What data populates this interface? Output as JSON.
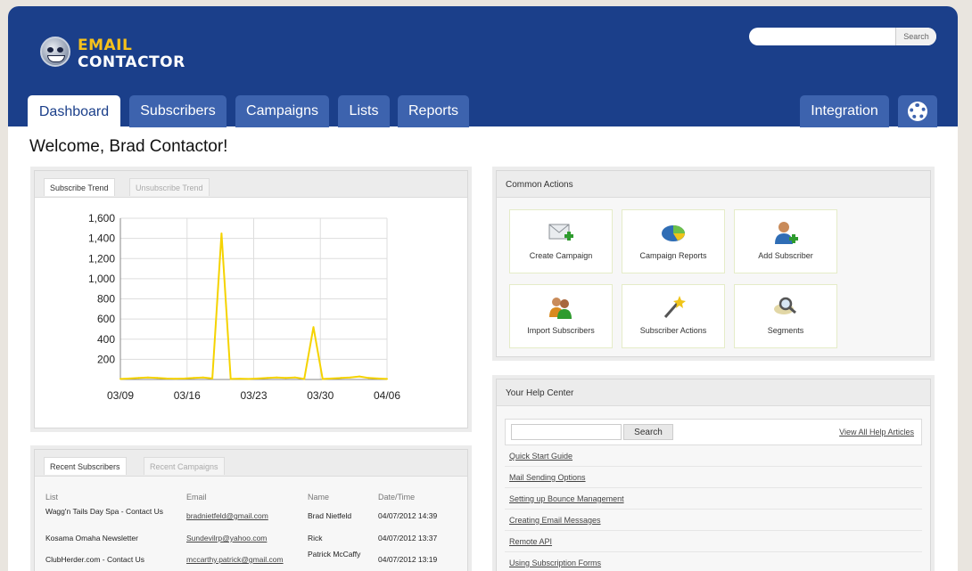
{
  "brand": {
    "line1": "EMAIL",
    "line2": "CONTACTOR"
  },
  "header_search": {
    "placeholder": "",
    "button_label": "Search"
  },
  "nav": {
    "tabs": [
      "Dashboard",
      "Subscribers",
      "Campaigns",
      "Lists",
      "Reports"
    ],
    "active_tab": "Dashboard",
    "integration_label": "Integration",
    "settings_icon": "gear-icon"
  },
  "welcome": "Welcome, Brad Contactor!",
  "trend_panel": {
    "tabs": [
      "Subscribe Trend",
      "Unsubscribe Trend"
    ],
    "active_tab": "Subscribe Trend"
  },
  "chart_data": {
    "type": "line",
    "title": "",
    "xlabel": "",
    "ylabel": "",
    "x_tick_labels": [
      "03/09",
      "03/16",
      "03/23",
      "03/30",
      "04/06"
    ],
    "y_tick_labels": [
      "200",
      "400",
      "600",
      "800",
      "1,000",
      "1,200",
      "1,400",
      "1,600"
    ],
    "ylim": [
      0,
      1600
    ],
    "grid": true,
    "series": [
      {
        "color": "#f5d300",
        "x": [
          0,
          1,
          2,
          3,
          4,
          5,
          6,
          7,
          8,
          9,
          10,
          11,
          12,
          13,
          14,
          15,
          16,
          17,
          18,
          19,
          20,
          21,
          22,
          23,
          24,
          25,
          26,
          27,
          28,
          29
        ],
        "values": [
          5,
          10,
          15,
          20,
          15,
          10,
          8,
          10,
          15,
          20,
          10,
          1450,
          5,
          8,
          5,
          10,
          15,
          20,
          15,
          20,
          5,
          520,
          5,
          10,
          15,
          20,
          30,
          15,
          10,
          5
        ]
      }
    ]
  },
  "recent_panel": {
    "tabs": [
      "Recent Subscribers",
      "Recent Campaigns"
    ],
    "active_tab": "Recent Subscribers",
    "columns": [
      "List",
      "Email",
      "Name",
      "Date/Time"
    ],
    "rows": [
      {
        "list": "Wagg'n Tails Day Spa - Contact Us",
        "email": "bradnietfeld@gmail.com",
        "name": "Brad Nietfeld",
        "datetime": "04/07/2012 14:39"
      },
      {
        "list": "Kosama Omaha Newsletter",
        "email": "Sundevilrp@yahoo.com",
        "name": "Rick",
        "datetime": "04/07/2012 13:37"
      },
      {
        "list": "ClubHerder.com - Contact Us",
        "email": "mccarthy.patrick@gmail.com",
        "name": "Patrick McCaffy",
        "datetime": "04/07/2012 13:19"
      }
    ]
  },
  "common_actions": {
    "title": "Common Actions",
    "items": [
      {
        "label": "Create Campaign",
        "icon": "envelope-add-icon"
      },
      {
        "label": "Campaign Reports",
        "icon": "pie-chart-icon"
      },
      {
        "label": "Add Subscriber",
        "icon": "user-add-icon"
      },
      {
        "label": "Import Subscribers",
        "icon": "users-import-icon"
      },
      {
        "label": "Subscriber Actions",
        "icon": "magic-wand-icon"
      },
      {
        "label": "Segments",
        "icon": "magnifier-icon"
      }
    ]
  },
  "help_center": {
    "title": "Your Help Center",
    "search_button": "Search",
    "view_all": "View All Help Articles",
    "links": [
      "Quick Start Guide",
      "Mail Sending Options",
      "Setting up Bounce Management",
      "Creating Email Messages",
      "Remote API",
      "Using Subscription Forms"
    ]
  }
}
